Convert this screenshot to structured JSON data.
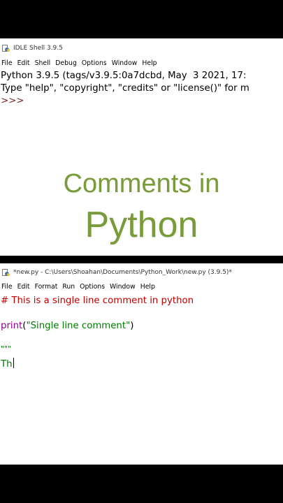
{
  "shell": {
    "title": "IDLE Shell 3.9.5",
    "menu": [
      "File",
      "Edit",
      "Shell",
      "Debug",
      "Options",
      "Window",
      "Help"
    ],
    "lines": [
      "Python 3.9.5 (tags/v3.9.5:0a7dcbd, May  3 2021, 17:",
      "Type \"help\", \"copyright\", \"credits\" or \"license()\" for m"
    ],
    "prompt": ">>>"
  },
  "overlay": {
    "line1": "Comments in",
    "line2": "Python"
  },
  "editor": {
    "title": "*new.py - C:\\Users\\Shoahan\\Documents\\Python_Work\\new.py (3.9.5)*",
    "menu": [
      "File",
      "Edit",
      "Format",
      "Run",
      "Options",
      "Window",
      "Help"
    ],
    "comment_line": "# This is a single line comment in python",
    "print_fn": "print",
    "print_open": "(",
    "print_arg": "\"Single line comment\"",
    "print_close": ")",
    "docstring_open": "\"\"\"",
    "typing_text": "Th"
  },
  "colors": {
    "comment": "#c00000",
    "builtin": "#900090",
    "string": "#007a00",
    "prompt": "#7d1f16",
    "overlay_text": "#7a9b3a"
  }
}
